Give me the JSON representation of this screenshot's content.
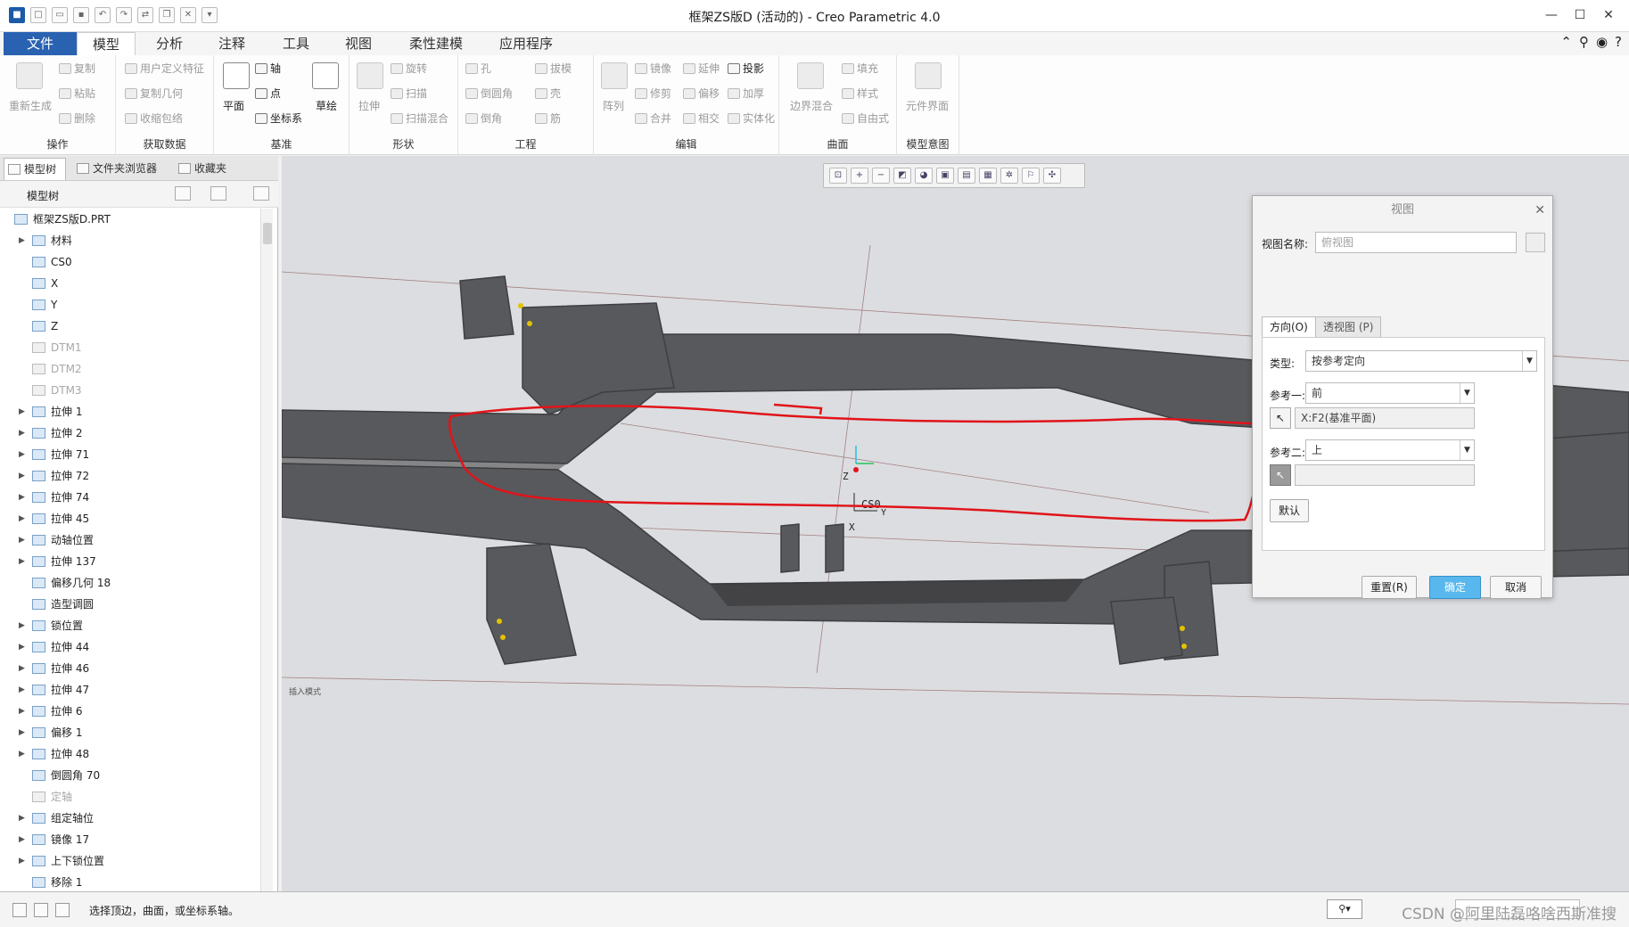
{
  "window": {
    "title": "框架ZS版D (活动的) - Creo Parametric 4.0",
    "quick_access_icons": [
      "app-icon",
      "new-icon",
      "open-icon",
      "save-icon",
      "undo-icon",
      "redo-icon",
      "regenerate-icon",
      "windows-icon",
      "close-window-icon",
      "customize-icon"
    ]
  },
  "ribbon_tabs": [
    "文件",
    "模型",
    "分析",
    "注释",
    "工具",
    "视图",
    "柔性建模",
    "应用程序"
  ],
  "ribbon": {
    "operations": {
      "label": "操作",
      "regenerate": "重新生成",
      "copy": "复制",
      "paste": "粘贴",
      "delete": "删除"
    },
    "get_data": {
      "label": "获取数据",
      "udf": "用户定义特征",
      "copy_geometry": "复制几何",
      "shrinkwrap": "收缩包络"
    },
    "datum": {
      "label": "基准",
      "plane": "平面",
      "axis": "轴",
      "point": "点",
      "csys": "坐标系",
      "sketch": "草绘"
    },
    "shapes": {
      "label": "形状",
      "extrude": "拉伸",
      "revolve": "旋转",
      "sweep": "扫描",
      "swept_blend": "扫描混合"
    },
    "engineering": {
      "label": "工程",
      "hole": "孔",
      "round": "倒圆角",
      "chamfer": "倒角",
      "draft": "拔模",
      "shell": "壳",
      "rib": "筋"
    },
    "editing": {
      "label": "编辑",
      "pattern": "阵列",
      "mirror": "镜像",
      "extend": "延伸",
      "project": "投影",
      "trim": "修剪",
      "offset": "偏移",
      "thicken": "加厚",
      "merge": "合并",
      "intersect": "相交",
      "solidify": "实体化"
    },
    "surfaces": {
      "label": "曲面",
      "boundary_blend": "边界混合",
      "fill": "填充",
      "style": "样式",
      "freestyle": "自由式"
    },
    "model_intent": {
      "label": "模型意图",
      "component_interface": "元件界面"
    }
  },
  "left_panel": {
    "tabs": [
      "模型树",
      "文件夹浏览器",
      "收藏夹"
    ],
    "toolbar_label": "模型树",
    "root": "框架ZS版D.PRT",
    "items": [
      {
        "label": "材料",
        "expand": "▶",
        "dim": false
      },
      {
        "label": "CS0",
        "expand": "",
        "dim": false
      },
      {
        "label": "X",
        "expand": "",
        "dim": false
      },
      {
        "label": "Y",
        "expand": "",
        "dim": false
      },
      {
        "label": "Z",
        "expand": "",
        "dim": false
      },
      {
        "label": "DTM1",
        "expand": "",
        "dim": true
      },
      {
        "label": "DTM2",
        "expand": "",
        "dim": true
      },
      {
        "label": "DTM3",
        "expand": "",
        "dim": true
      },
      {
        "label": "拉伸 1",
        "expand": "▶",
        "dim": false
      },
      {
        "label": "拉伸 2",
        "expand": "▶",
        "dim": false
      },
      {
        "label": "拉伸 71",
        "expand": "▶",
        "dim": false
      },
      {
        "label": "拉伸 72",
        "expand": "▶",
        "dim": false
      },
      {
        "label": "拉伸 74",
        "expand": "▶",
        "dim": false
      },
      {
        "label": "拉伸 45",
        "expand": "▶",
        "dim": false
      },
      {
        "label": "动轴位置",
        "expand": "▶",
        "dim": false
      },
      {
        "label": "拉伸 137",
        "expand": "▶",
        "dim": false
      },
      {
        "label": "偏移几何 18",
        "expand": "",
        "dim": false
      },
      {
        "label": "造型调圆",
        "expand": "",
        "dim": false
      },
      {
        "label": "锁位置",
        "expand": "▶",
        "dim": false
      },
      {
        "label": "拉伸 44",
        "expand": "▶",
        "dim": false
      },
      {
        "label": "拉伸 46",
        "expand": "▶",
        "dim": false
      },
      {
        "label": "拉伸 47",
        "expand": "▶",
        "dim": false
      },
      {
        "label": "拉伸 6",
        "expand": "▶",
        "dim": false
      },
      {
        "label": "偏移 1",
        "expand": "▶",
        "dim": false
      },
      {
        "label": "拉伸 48",
        "expand": "▶",
        "dim": false
      },
      {
        "label": "倒圆角 70",
        "expand": "",
        "dim": false
      },
      {
        "label": "定轴",
        "expand": "",
        "dim": true
      },
      {
        "label": "组定轴位",
        "expand": "▶",
        "dim": false
      },
      {
        "label": "镜像 17",
        "expand": "▶",
        "dim": false
      },
      {
        "label": "上下锁位置",
        "expand": "▶",
        "dim": false
      },
      {
        "label": "移除 1",
        "expand": "",
        "dim": false
      }
    ]
  },
  "viewport": {
    "csys_label": "CS0",
    "axis_x": "X",
    "axis_y": "Y",
    "axis_z": "Z",
    "small_text": "插入模式",
    "colors": {
      "background": "#dcdde0",
      "model": "#5a5a5c",
      "annotation": "#e0141a"
    }
  },
  "view_dialog": {
    "title": "视图",
    "view_name_label": "视图名称:",
    "view_name_placeholder": "俯视图",
    "tabs": [
      "方向(O)",
      "透视图 (P)"
    ],
    "type_label": "类型:",
    "type_value": "按参考定向",
    "ref1_label": "参考一:",
    "ref1_value": "前",
    "ref1_selection": "X:F2(基准平面)",
    "ref2_label": "参考二:",
    "ref2_value": "上",
    "ref2_selection": "",
    "default_button": "默认",
    "reset_button": "重置(R)",
    "ok_button": "确定",
    "cancel_button": "取消"
  },
  "status_bar": {
    "message": "选择顶边，曲面，或坐标系轴。",
    "watermark": "CSDN @阿里陆磊咯啥西斯准搜"
  }
}
